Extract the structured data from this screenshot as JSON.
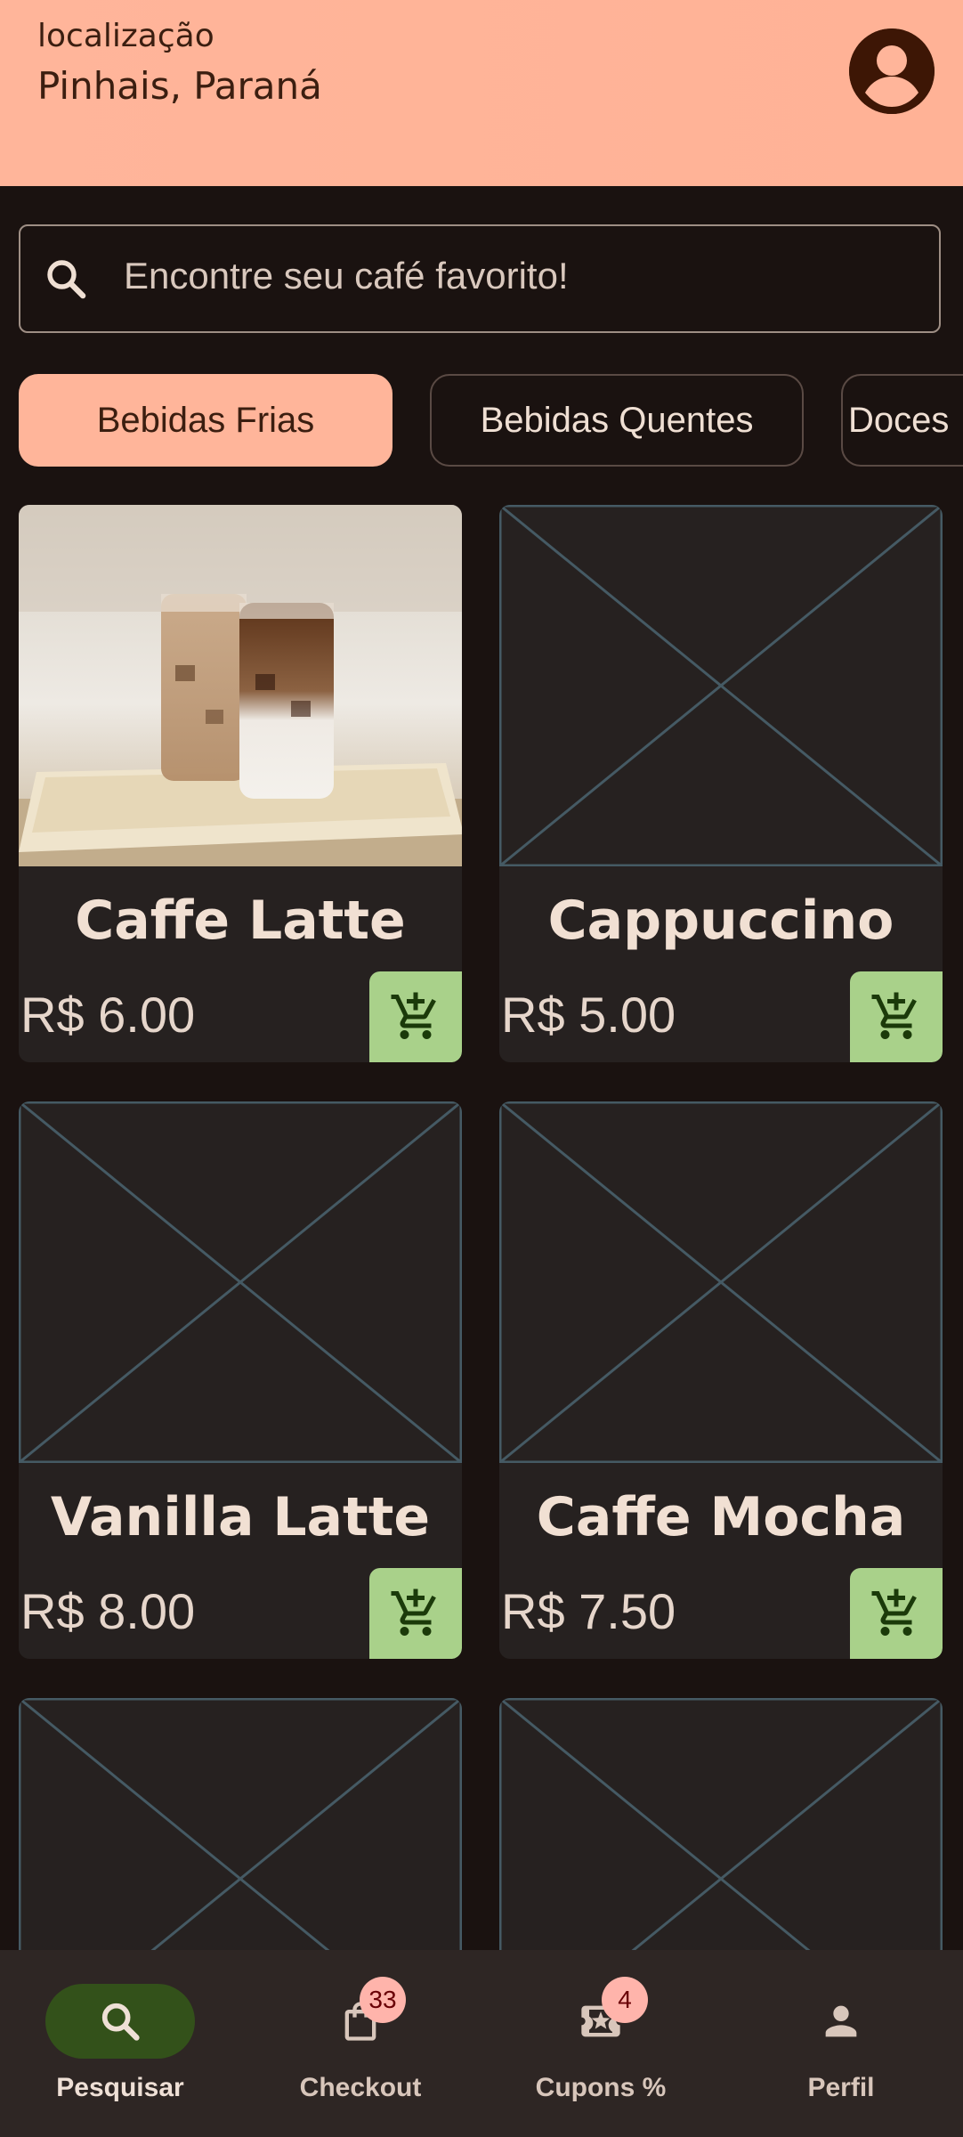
{
  "header": {
    "location_label": "localização",
    "location_value": "Pinhais, Paraná",
    "avatar_icon": "account-circle-icon"
  },
  "search": {
    "placeholder": "Encontre seu café favorito!",
    "icon": "search-icon"
  },
  "categories": [
    {
      "label": "Bebidas Frias",
      "selected": true
    },
    {
      "label": "Bebidas Quentes",
      "selected": false
    },
    {
      "label": "Doces",
      "selected": false
    }
  ],
  "products": [
    {
      "name": "Caffe Latte",
      "price": "R$ 6.00",
      "image": "iced-latte-photo"
    },
    {
      "name": "Cappuccino",
      "price": "R$ 5.00",
      "image": "placeholder"
    },
    {
      "name": "Vanilla Latte",
      "price": "R$ 8.00",
      "image": "placeholder"
    },
    {
      "name": "Caffe Mocha",
      "price": "R$ 7.50",
      "image": "placeholder"
    }
  ],
  "nav": [
    {
      "label": "Pesquisar",
      "icon": "search-icon",
      "active": true
    },
    {
      "label": "Checkout",
      "icon": "shopping-bag-icon",
      "badge": "33"
    },
    {
      "label": "Cupons %",
      "icon": "coupon-icon",
      "badge": "4"
    },
    {
      "label": "Perfil",
      "icon": "person-icon"
    }
  ],
  "colors": {
    "header_bg": "#ffb59a",
    "background": "#1a1210",
    "card_bg": "#262120",
    "cart_button": "#a9d18a",
    "nav_active": "#33511a",
    "badge": "#ffb4ab"
  }
}
